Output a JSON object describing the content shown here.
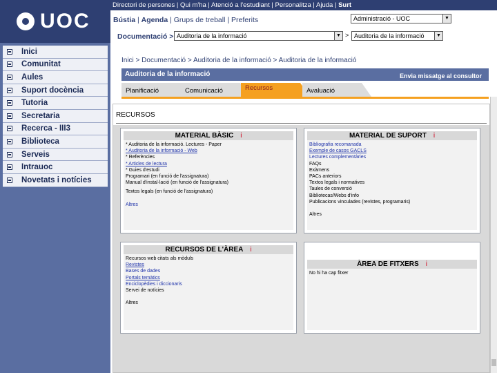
{
  "logo": {
    "text": "UOC"
  },
  "sidebar": {
    "items": [
      {
        "label": "Inici"
      },
      {
        "label": "Comunitat"
      },
      {
        "label": "Aules"
      },
      {
        "label": "Suport docència"
      },
      {
        "label": "Tutoria"
      },
      {
        "label": "Secretaria"
      },
      {
        "label": "Recerca - III3"
      },
      {
        "label": "Biblioteca"
      },
      {
        "label": "Serveis"
      },
      {
        "label": "Intrauoc"
      },
      {
        "label": "Novetats i notícies"
      }
    ]
  },
  "topbar": {
    "links": [
      "Directori de persones",
      "Qui m'ha",
      "Atenció a l'estudiant",
      "Personalitza",
      "Ajuda"
    ],
    "exit": "Surt"
  },
  "quicklinks": {
    "bustia": "Bústia",
    "agenda": "Agenda",
    "grups": "Grups de treball",
    "preferits": "Preferits"
  },
  "role_select": {
    "value": "Administració - UOC"
  },
  "doc_nav": {
    "label": "Documentació",
    "arrow": ">",
    "select1": "Auditoria de la informació",
    "select2": "Auditoria de la informació"
  },
  "breadcrumb": "Inici > Documentació > Auditoria de la informació > Auditoria de la informació",
  "title_bar": {
    "title": "Auditoria de la informació",
    "contact": "Envia missatge al consultor"
  },
  "tabs": [
    {
      "label": "Planificació"
    },
    {
      "label": "Comunicació"
    },
    {
      "label": "Recursos"
    },
    {
      "label": "Avaluació"
    }
  ],
  "content": {
    "heading": "RECURSOS"
  },
  "panels": {
    "basic": {
      "title": "MATERIAL BÀSIC",
      "info": "i",
      "lines": [
        "* Auditoria de la informació. Lectures - Paper",
        "* Auditoria de la informació - Web",
        "* Referències",
        "* Articles de lectura",
        "* Guies d'estudi",
        "Programari (en funció de l'assignatura)",
        "Manual d'instal·lació (en funció de l'assignatura)",
        "Textos legals (en funció de l'assignatura)",
        "Altres"
      ]
    },
    "support": {
      "title": "MATERIAL DE SUPORT",
      "info": "i",
      "lines": [
        "Bibliografia recomanada",
        "Exemple de casos GACLS",
        "Lectures complementàries",
        "FAQs",
        "Exàmens",
        "PACs anteriors",
        "Textos legals i normatives",
        "Taules de conversió",
        "Bibliotecas/Webs d'info",
        "Publicacions vinculades (revistes, programaris)",
        "Altres"
      ]
    },
    "area": {
      "title": "RECURSOS DE L'ÀREA",
      "info": "i",
      "lines": [
        "Recursos web citats als mòduls",
        "Revistes",
        "Bases de dades",
        "Portals temàtics",
        "Enciclopèdies i diccionaris",
        "Servei de notícies",
        "Altres"
      ]
    },
    "files": {
      "title": "ÀREA DE FITXERS",
      "info": "i",
      "lines": [
        "No hi ha cap fitxer"
      ]
    }
  }
}
